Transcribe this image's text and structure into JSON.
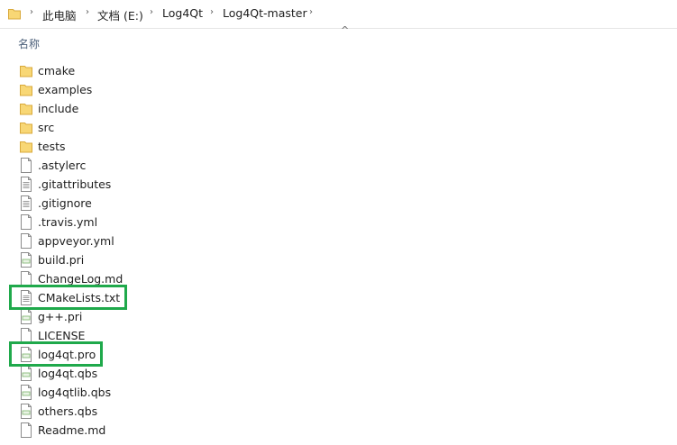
{
  "breadcrumb": {
    "items": [
      "此电脑",
      "文档 (E:)",
      "Log4Qt",
      "Log4Qt-master"
    ]
  },
  "columns": {
    "name_header": "名称"
  },
  "files": [
    {
      "name": "cmake",
      "icon": "folder-icon"
    },
    {
      "name": "examples",
      "icon": "folder-icon"
    },
    {
      "name": "include",
      "icon": "folder-icon"
    },
    {
      "name": "src",
      "icon": "folder-icon"
    },
    {
      "name": "tests",
      "icon": "folder-icon"
    },
    {
      "name": ".astylerc",
      "icon": "file-icon"
    },
    {
      "name": ".gitattributes",
      "icon": "text-file-icon"
    },
    {
      "name": ".gitignore",
      "icon": "text-file-icon"
    },
    {
      "name": ".travis.yml",
      "icon": "file-icon"
    },
    {
      "name": "appveyor.yml",
      "icon": "file-icon"
    },
    {
      "name": "build.pri",
      "icon": "pri-file-icon"
    },
    {
      "name": "ChangeLog.md",
      "icon": "file-icon"
    },
    {
      "name": "CMakeLists.txt",
      "icon": "text-file-icon",
      "highlighted": true
    },
    {
      "name": "g++.pri",
      "icon": "pri-file-icon"
    },
    {
      "name": "LICENSE",
      "icon": "file-icon"
    },
    {
      "name": "log4qt.pro",
      "icon": "pro-file-icon",
      "highlighted": true
    },
    {
      "name": "log4qt.qbs",
      "icon": "pro-file-icon"
    },
    {
      "name": "log4qtlib.qbs",
      "icon": "pro-file-icon"
    },
    {
      "name": "others.qbs",
      "icon": "pro-file-icon"
    },
    {
      "name": "Readme.md",
      "icon": "file-icon"
    }
  ],
  "colors": {
    "folder": "#f8d775",
    "highlight": "#1fa94b",
    "header_text": "#4c607a"
  }
}
